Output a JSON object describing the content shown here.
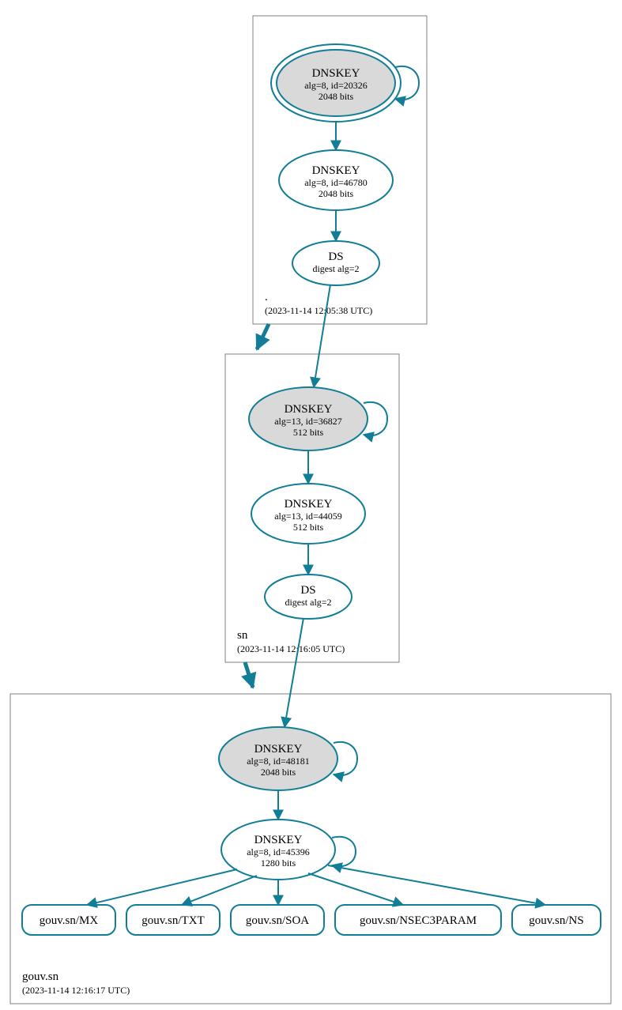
{
  "zones": {
    "root": {
      "label": ".",
      "timestamp": "(2023-11-14 12:05:38 UTC)",
      "nodes": {
        "dnskey1": {
          "title": "DNSKEY",
          "line2": "alg=8, id=20326",
          "line3": "2048 bits"
        },
        "dnskey2": {
          "title": "DNSKEY",
          "line2": "alg=8, id=46780",
          "line3": "2048 bits"
        },
        "ds": {
          "title": "DS",
          "line2": "digest alg=2"
        }
      }
    },
    "sn": {
      "label": "sn",
      "timestamp": "(2023-11-14 12:16:05 UTC)",
      "nodes": {
        "dnskey1": {
          "title": "DNSKEY",
          "line2": "alg=13, id=36827",
          "line3": "512 bits"
        },
        "dnskey2": {
          "title": "DNSKEY",
          "line2": "alg=13, id=44059",
          "line3": "512 bits"
        },
        "ds": {
          "title": "DS",
          "line2": "digest alg=2"
        }
      }
    },
    "gouvsn": {
      "label": "gouv.sn",
      "timestamp": "(2023-11-14 12:16:17 UTC)",
      "nodes": {
        "dnskey1": {
          "title": "DNSKEY",
          "line2": "alg=8, id=48181",
          "line3": "2048 bits"
        },
        "dnskey2": {
          "title": "DNSKEY",
          "line2": "alg=8, id=45396",
          "line3": "1280 bits"
        }
      },
      "leaves": {
        "mx": "gouv.sn/MX",
        "txt": "gouv.sn/TXT",
        "soa": "gouv.sn/SOA",
        "nsec3param": "gouv.sn/NSEC3PARAM",
        "ns": "gouv.sn/NS"
      }
    }
  }
}
